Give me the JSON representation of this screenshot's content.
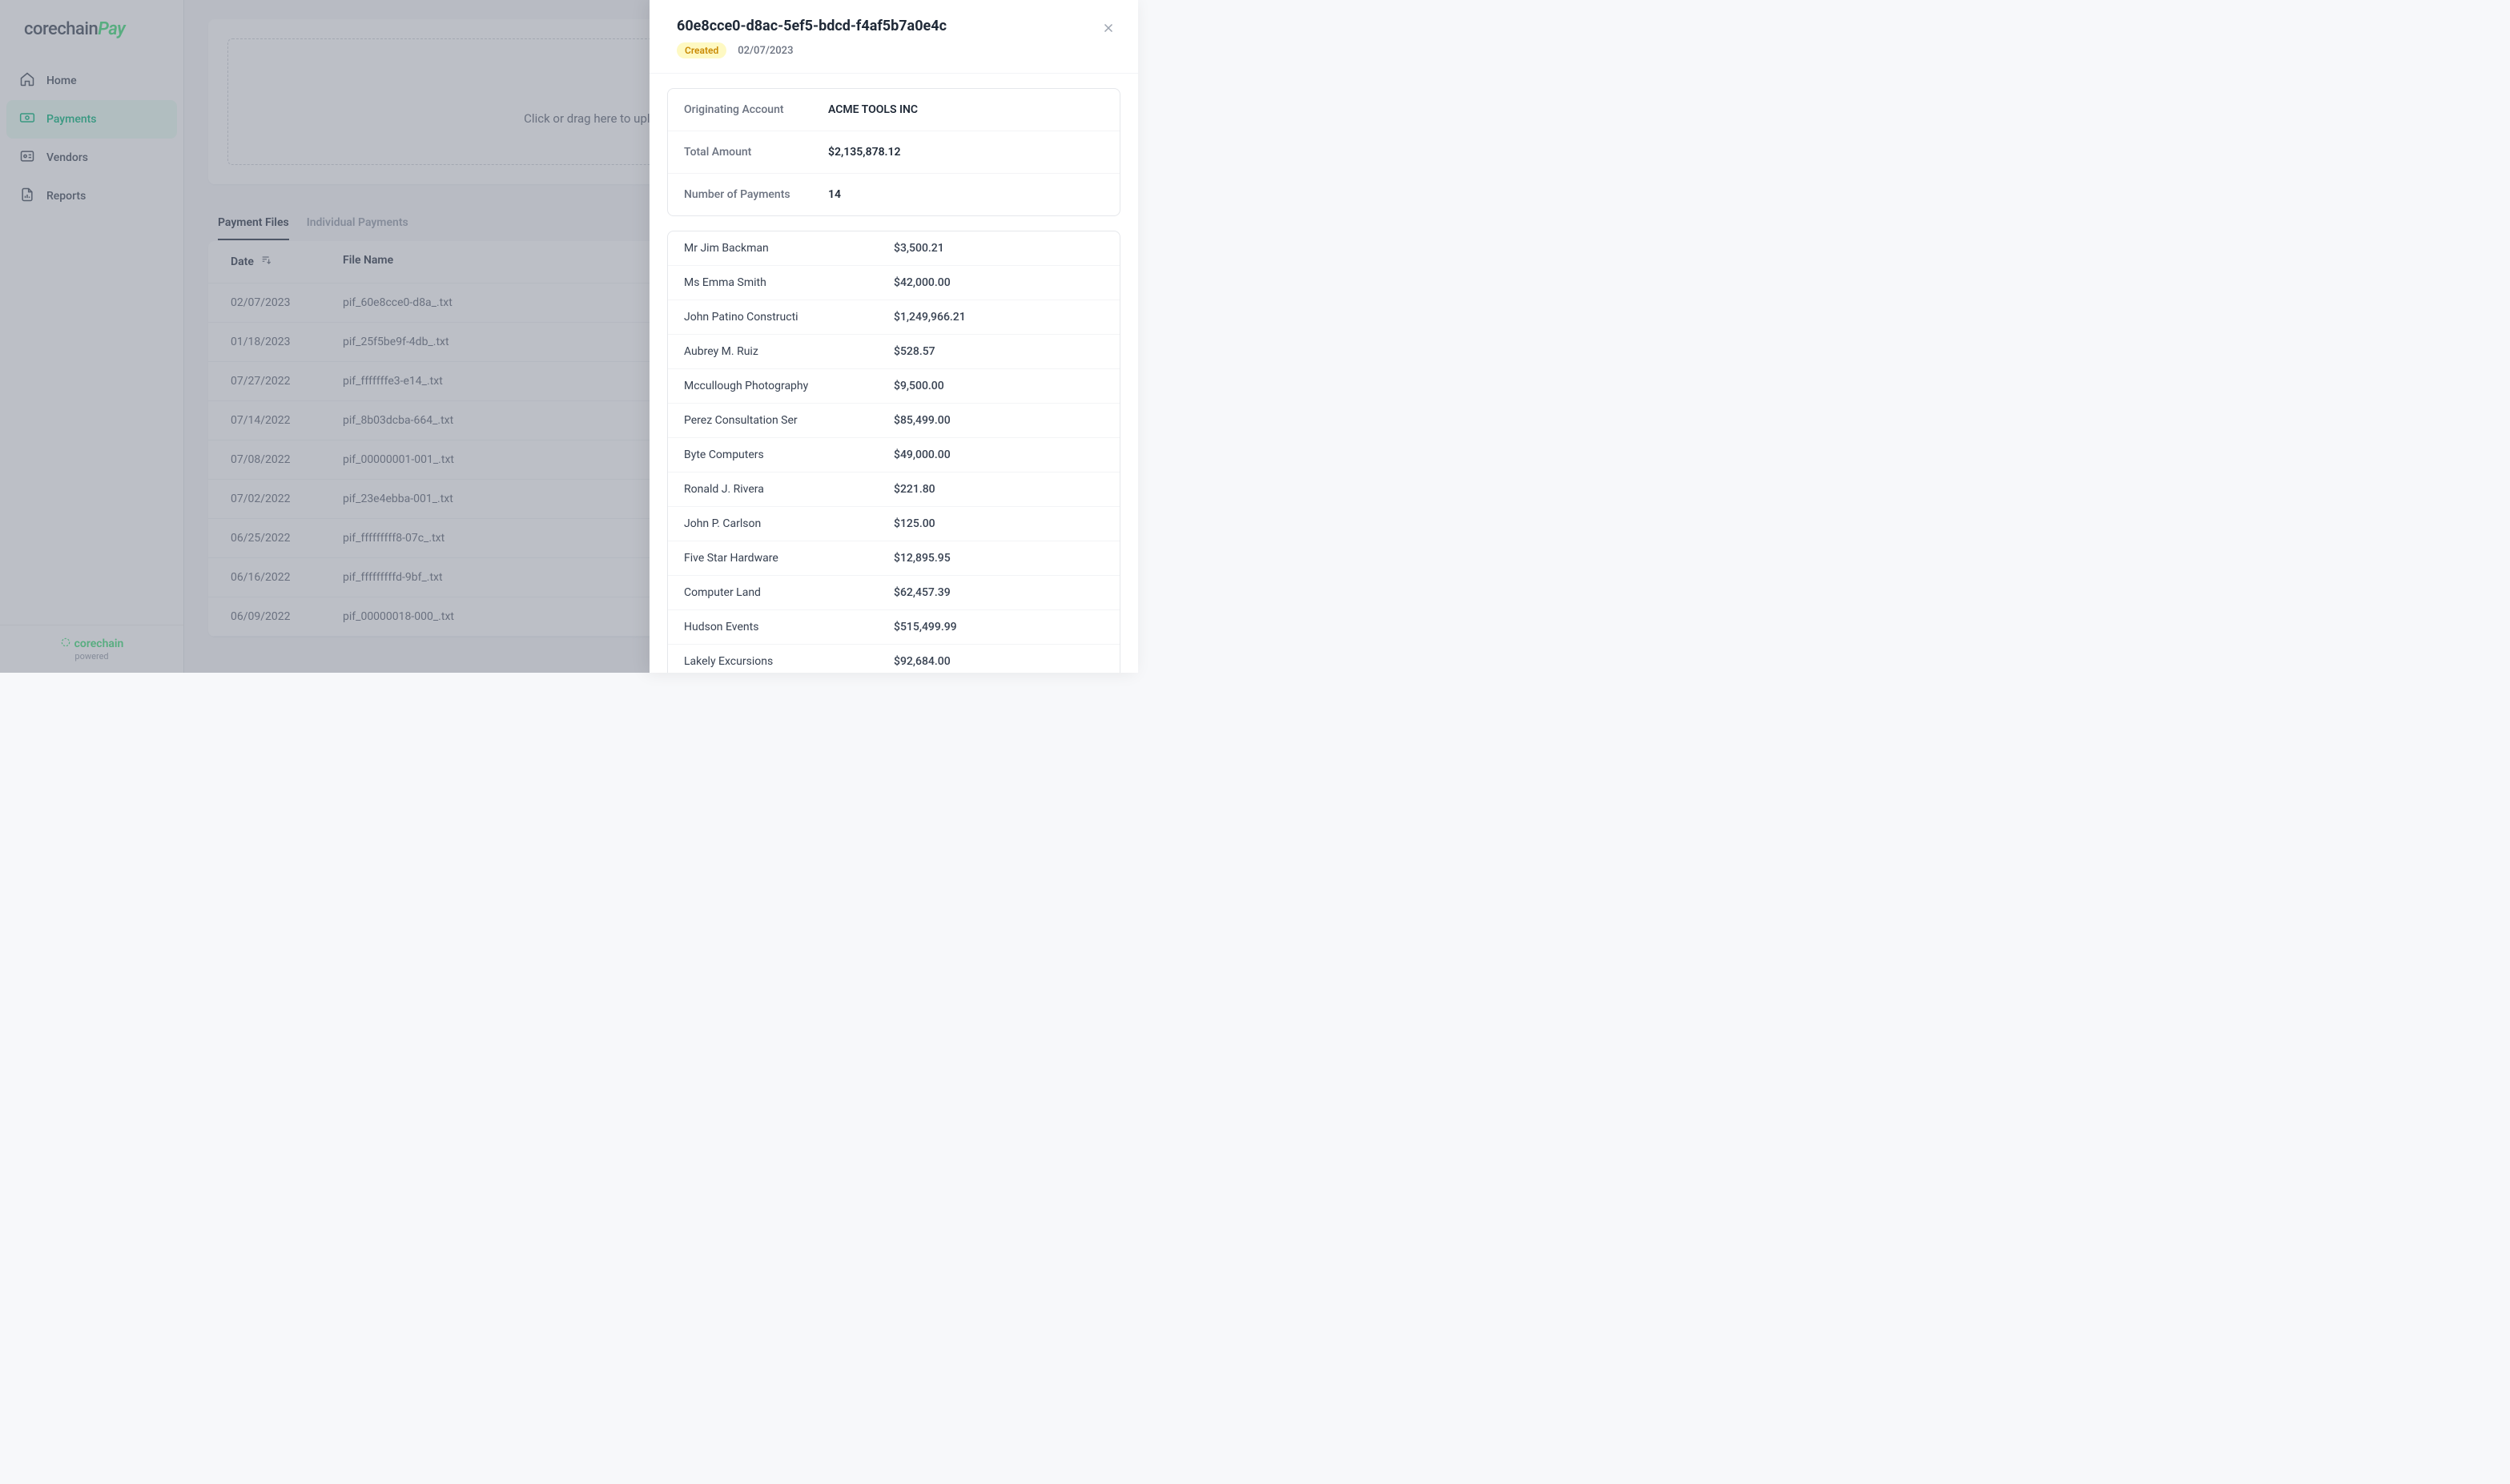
{
  "logo": {
    "brand": "corechain",
    "suffix": "Pay"
  },
  "sidebar": {
    "items": [
      {
        "label": "Home",
        "icon": "home"
      },
      {
        "label": "Payments",
        "icon": "payments",
        "active": true
      },
      {
        "label": "Vendors",
        "icon": "vendors"
      },
      {
        "label": "Reports",
        "icon": "reports"
      }
    ]
  },
  "footer": {
    "brand": "corechain",
    "powered": "powered"
  },
  "upload": {
    "text": "Click or drag here to upload payment instruction file"
  },
  "tabs": [
    {
      "label": "Payment Files",
      "active": true
    },
    {
      "label": "Individual Payments"
    }
  ],
  "table": {
    "headers": {
      "date": "Date",
      "file": "File Name"
    },
    "rows": [
      {
        "date": "02/07/2023",
        "file": "pif_60e8cce0-d8a_.txt"
      },
      {
        "date": "01/18/2023",
        "file": "pif_25f5be9f-4db_.txt"
      },
      {
        "date": "07/27/2022",
        "file": "pif_fffffffe3-e14_.txt"
      },
      {
        "date": "07/14/2022",
        "file": "pif_8b03dcba-664_.txt"
      },
      {
        "date": "07/08/2022",
        "file": "pif_00000001-001_.txt"
      },
      {
        "date": "07/02/2022",
        "file": "pif_23e4ebba-001_.txt"
      },
      {
        "date": "06/25/2022",
        "file": "pif_fffffffff8-07c_.txt"
      },
      {
        "date": "06/16/2022",
        "file": "pif_fffffffffd-9bf_.txt"
      },
      {
        "date": "06/09/2022",
        "file": "pif_00000018-000_.txt"
      }
    ]
  },
  "drawer": {
    "title": "60e8cce0-d8ac-5ef5-bdcd-f4af5b7a0e4c",
    "badge": "Created",
    "date": "02/07/2023",
    "info": [
      {
        "label": "Originating Account",
        "value": "ACME TOOLS INC"
      },
      {
        "label": "Total Amount",
        "value": "$2,135,878.12"
      },
      {
        "label": "Number of Payments",
        "value": "14"
      }
    ],
    "payments": [
      {
        "name": "Mr Jim Backman",
        "amount": "$3,500.21"
      },
      {
        "name": "Ms Emma Smith",
        "amount": "$42,000.00"
      },
      {
        "name": "John Patino Constructi",
        "amount": "$1,249,966.21"
      },
      {
        "name": "Aubrey M. Ruiz",
        "amount": "$528.57"
      },
      {
        "name": "Mccullough Photography",
        "amount": "$9,500.00"
      },
      {
        "name": "Perez Consultation Ser",
        "amount": "$85,499.00"
      },
      {
        "name": "Byte Computers",
        "amount": "$49,000.00"
      },
      {
        "name": "Ronald J. Rivera",
        "amount": "$221.80"
      },
      {
        "name": "John P. Carlson",
        "amount": "$125.00"
      },
      {
        "name": "Five Star Hardware",
        "amount": "$12,895.95"
      },
      {
        "name": "Computer Land",
        "amount": "$62,457.39"
      },
      {
        "name": "Hudson Events",
        "amount": "$515,499.99"
      },
      {
        "name": "Lakely Excursions",
        "amount": "$92,684.00"
      }
    ]
  }
}
